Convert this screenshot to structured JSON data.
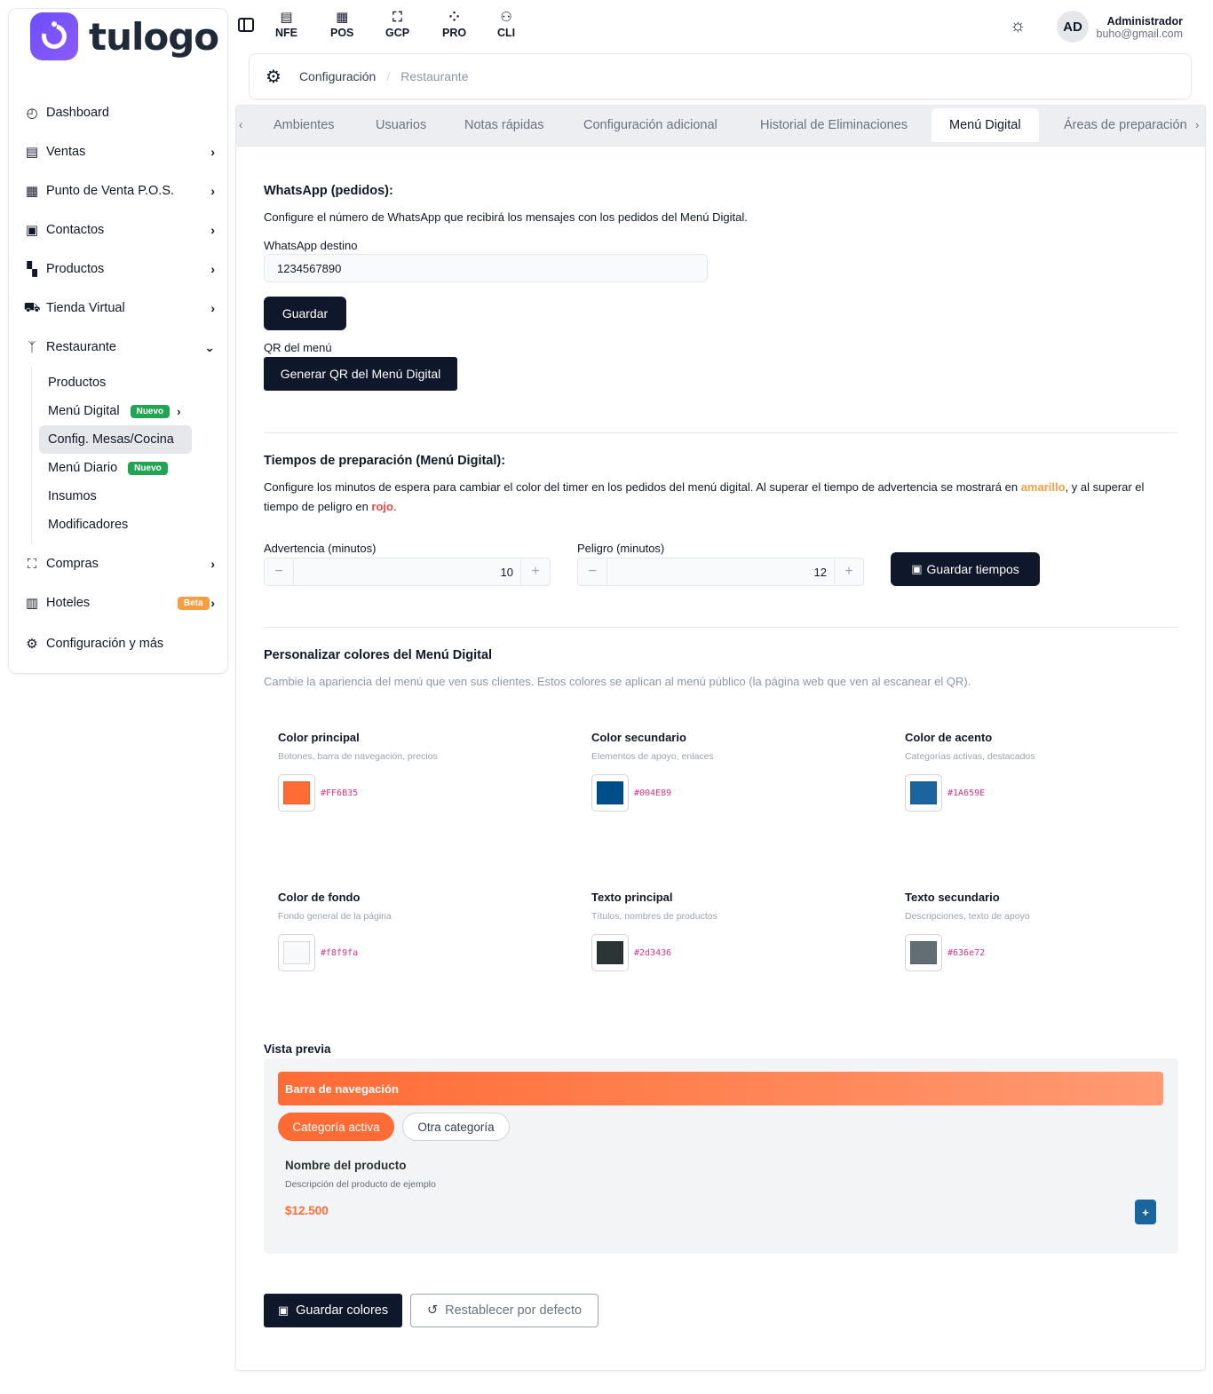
{
  "brand": {
    "name": "tulogo"
  },
  "sidebar": {
    "items": [
      {
        "label": "Dashboard",
        "icon": "dashboard-icon",
        "glyph": "◴"
      },
      {
        "label": "Ventas",
        "icon": "document-icon",
        "glyph": "▤"
      },
      {
        "label": "Punto de Venta P.O.S.",
        "icon": "pos-icon",
        "glyph": "▦"
      },
      {
        "label": "Contactos",
        "icon": "contacts-icon",
        "glyph": "▣"
      },
      {
        "label": "Productos",
        "icon": "grid-icon",
        "glyph": "▚"
      },
      {
        "label": "Tienda Virtual",
        "icon": "cart-icon",
        "glyph": "⛟"
      },
      {
        "label": "Restaurante",
        "icon": "utensils-icon",
        "glyph": "ᛉ"
      }
    ],
    "restaurante_sub": [
      {
        "label": "Productos"
      },
      {
        "label": "Menú Digital",
        "badge": "Nuevo"
      },
      {
        "label": "Config. Mesas/Cocina"
      },
      {
        "label": "Menú Diario",
        "badge": "Nuevo"
      },
      {
        "label": "Insumos"
      },
      {
        "label": "Modificadores"
      }
    ],
    "bottom_items": [
      {
        "label": "Compras",
        "icon": "bag-icon",
        "glyph": "⛶"
      },
      {
        "label": "Hoteles",
        "icon": "building-icon",
        "glyph": "▥",
        "badge": "Beta"
      },
      {
        "label": "Configuración y más",
        "icon": "gear-icon",
        "glyph": "⚙"
      }
    ]
  },
  "topbar": {
    "links": [
      {
        "label": "NFE",
        "glyph": "▤"
      },
      {
        "label": "POS",
        "glyph": "▦"
      },
      {
        "label": "GCP",
        "glyph": "⛶"
      },
      {
        "label": "PRO",
        "glyph": "⁘"
      },
      {
        "label": "CLI",
        "glyph": "⚇"
      }
    ],
    "user": {
      "initials": "AD",
      "name": "Administrador",
      "email": "buho@gmail.com"
    }
  },
  "breadcrumb": {
    "first": "Configuración",
    "second": "Restaurante"
  },
  "tabs": [
    "Ambientes",
    "Usuarios",
    "Notas rápidas",
    "Configuración adicional",
    "Historial de Eliminaciones",
    "Menú Digital",
    "Áreas de preparación"
  ],
  "whatsapp": {
    "title": "WhatsApp (pedidos):",
    "description": "Configure el número de WhatsApp que recibirá los mensajes con los pedidos del Menú Digital.",
    "field_label": "WhatsApp destino",
    "value": "1234567890",
    "save_label": "Guardar",
    "qr_label": "QR del menú",
    "qr_button": "Generar QR del Menú Digital"
  },
  "tiempos": {
    "title": "Tiempos de preparación (Menú Digital):",
    "desc_1": "Configure los minutos de espera para cambiar el color del timer en los pedidos del menú digital. Al superar el tiempo de advertencia se mostrará en ",
    "amarillo": "amarillo",
    "desc_2": ", y al superar el tiempo de peligro en ",
    "rojo": "rojo",
    "desc_3": ".",
    "advertencia_label": "Advertencia (minutos)",
    "advertencia_value": "10",
    "peligro_label": "Peligro (minutos)",
    "peligro_value": "12",
    "save_label": "Guardar tiempos"
  },
  "colores": {
    "title": "Personalizar colores del Menú Digital",
    "description": "Cambie la apariencia del menú que ven sus clientes. Estos colores se aplican al menú público (la página web que ven al escanear el QR).",
    "items": [
      {
        "name": "Color principal",
        "desc": "Botones, barra de navegación, precios",
        "hex": "#FF6B35",
        "color": "#ff6b35"
      },
      {
        "name": "Color secundario",
        "desc": "Elementos de apoyo, enlaces",
        "hex": "#004E89",
        "color": "#004e89"
      },
      {
        "name": "Color de acento",
        "desc": "Categorías activas, destacados",
        "hex": "#1A659E",
        "color": "#1a659e"
      },
      {
        "name": "Color de fondo",
        "desc": "Fondo general de la página",
        "hex": "#f8f9fa",
        "color": "#f8f9fa"
      },
      {
        "name": "Texto principal",
        "desc": "Títulos, nombres de productos",
        "hex": "#2d3436",
        "color": "#2d3436"
      },
      {
        "name": "Texto secundario",
        "desc": "Descripciones, texto de apoyo",
        "hex": "#636e72",
        "color": "#636e72"
      }
    ]
  },
  "preview": {
    "title": "Vista previa",
    "nav": "Barra de navegación",
    "active_category": "Categoría activa",
    "other_category": "Otra categoría",
    "product_name": "Nombre del producto",
    "product_desc": "Descripción del producto de ejemplo",
    "price": "$12.500",
    "add": "+"
  },
  "actions": {
    "save_colors": "Guardar colores",
    "reset": "Restablecer por defecto"
  }
}
